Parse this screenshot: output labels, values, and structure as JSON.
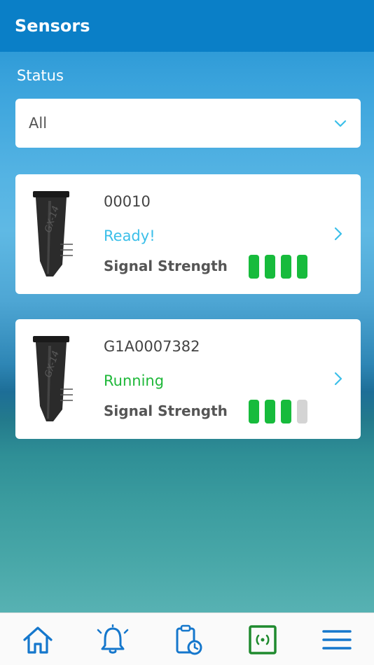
{
  "header": {
    "title": "Sensors"
  },
  "filter": {
    "label": "Status",
    "selected": "All"
  },
  "sensors": [
    {
      "id": "00010",
      "status": "Ready!",
      "signal_label": "Signal Strength",
      "signal_level": 4,
      "signal_max": 4
    },
    {
      "id": "G1A0007382",
      "status": "Running",
      "signal_label": "Signal Strength",
      "signal_level": 3,
      "signal_max": 4
    }
  ],
  "nav": [
    "home-icon",
    "alarm-bell-icon",
    "clipboard-clock-icon",
    "sensor-signal-icon",
    "menu-icon"
  ],
  "colors": {
    "header": "#0a7fc7",
    "ready": "#3bbfe9",
    "running": "#1fb83a",
    "signal_on": "#17bb3c",
    "signal_off": "#d4d4d4",
    "nav_icon": "#1577cc",
    "nav_active": "#1f8a2e"
  }
}
